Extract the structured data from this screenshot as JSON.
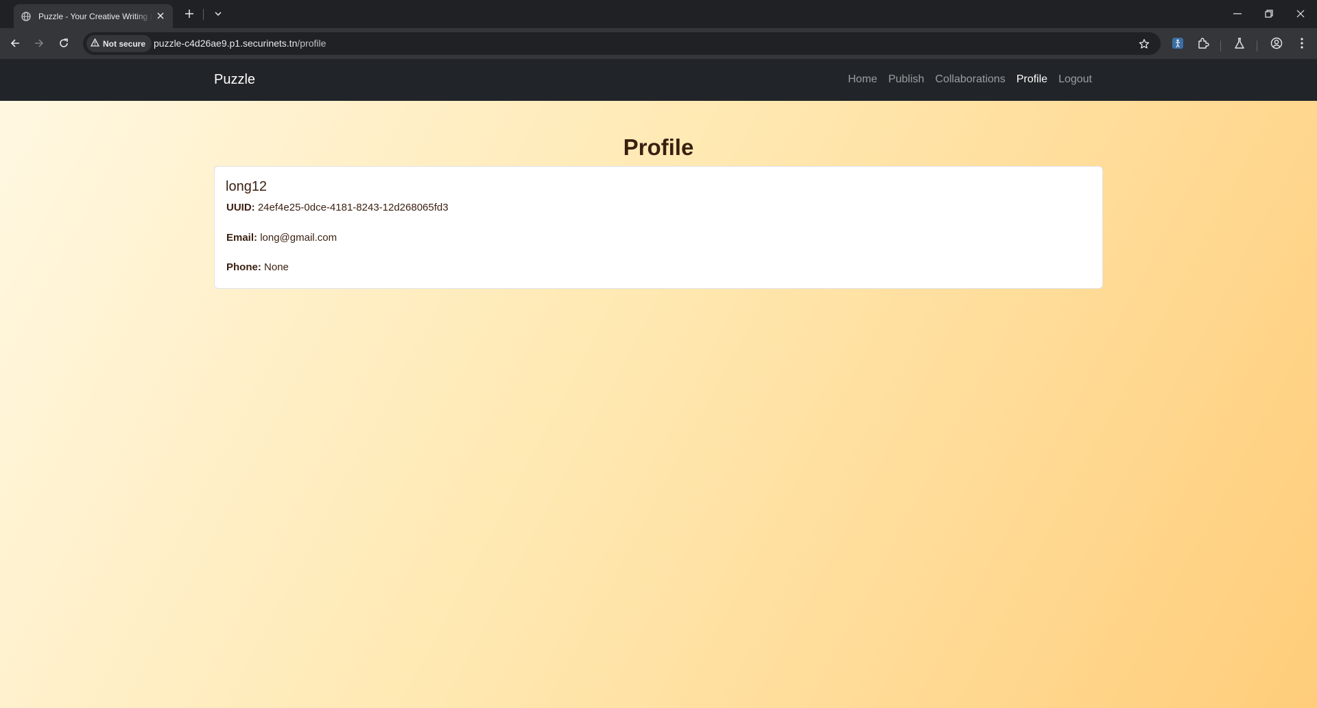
{
  "browser": {
    "tab_title": "Puzzle - Your Creative Writing Hub",
    "security_label": "Not secure",
    "url_host": "puzzle-c4d26ae9.p1.securinets.tn",
    "url_path": "/profile"
  },
  "site": {
    "brand": "Puzzle",
    "nav": [
      "Home",
      "Publish",
      "Collaborations",
      "Profile",
      "Logout"
    ],
    "active_nav": "Profile"
  },
  "profile": {
    "heading": "Profile",
    "username": "long12",
    "uuid_label": "UUID:",
    "uuid": "24ef4e25-0dce-4181-8243-12d268065fd3",
    "email_label": "Email:",
    "email": "long@gmail.com",
    "phone_label": "Phone:",
    "phone": "None"
  },
  "colors": {
    "navbar_bg": "#212529",
    "page_gradient_start": "#fff8e3",
    "page_gradient_end": "#ffcd7a",
    "text_brown": "#3a1f10"
  }
}
